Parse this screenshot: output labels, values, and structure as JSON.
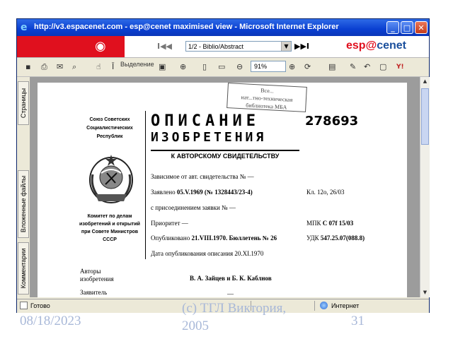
{
  "window": {
    "title": "http://v3.espacenet.com - esp@cenet maximised view - Microsoft Internet Explorer",
    "buttons": [
      "_",
      "□",
      "✕"
    ]
  },
  "espacenet": {
    "page_select": "1/2 - Biblio/Abstract",
    "nav_first": "I◀◀",
    "nav_last": "▶▶I",
    "brand_prefix": "esp",
    "brand_at": "@",
    "brand_suffix": "cenet"
  },
  "toolbar": {
    "select_label": "Выделение",
    "zoom_value": "91%"
  },
  "side_tabs": [
    "Страницы",
    "Вложенные файлы",
    "Комментарии"
  ],
  "document": {
    "stamp_lines": [
      "Все...",
      "нат...тно-техническая",
      "библиотека МБА"
    ],
    "org_lines": [
      "Союз Советских",
      "Социалистических",
      "Республик"
    ],
    "committee_lines": [
      "Комитет по делам",
      "изобретений и открытий",
      "при Совете Министров",
      "СССР"
    ],
    "title_line1": "ОПИСАНИЕ",
    "title_line2": "ИЗОБРЕТЕНИЯ",
    "doc_number": "278693",
    "subtitle": "К АВТОРСКОМУ СВИДЕТЕЛЬСТВУ",
    "f1": "Зависимое от авт. свидетельства № —",
    "f2_label": "Заявлено",
    "f2_value": "05.V.1969 (№ 1328443/23-4)",
    "f3": "с присоединением заявки № —",
    "f4": "Приоритет —",
    "f5_label": "Опубликовано",
    "f5_value": "21.VIII.1970. Бюллетень № 26",
    "f6": "Дата опубликования описания 20.XI.1970",
    "r1_label": "Кл.",
    "r1_value": "12o, 26/03",
    "r2_label": "МПК",
    "r2_value": "C 07f 15/03",
    "r3_label": "УДК",
    "r3_value": "547.25.07(088.8)",
    "authors_label_1": "Авторы",
    "authors_label_2": "изобретения",
    "authors": "В. А. Зайцев и Б. К. Каблнов",
    "applicant_label": "Заявитель",
    "applicant": "—"
  },
  "statusbar": {
    "status": "Готово",
    "zone": "Интернет"
  },
  "slide_footer": {
    "date": "08/18/2023",
    "center_line1": "(c) ТГЛ Виктория,",
    "center_line2": "2005",
    "page": "31"
  }
}
